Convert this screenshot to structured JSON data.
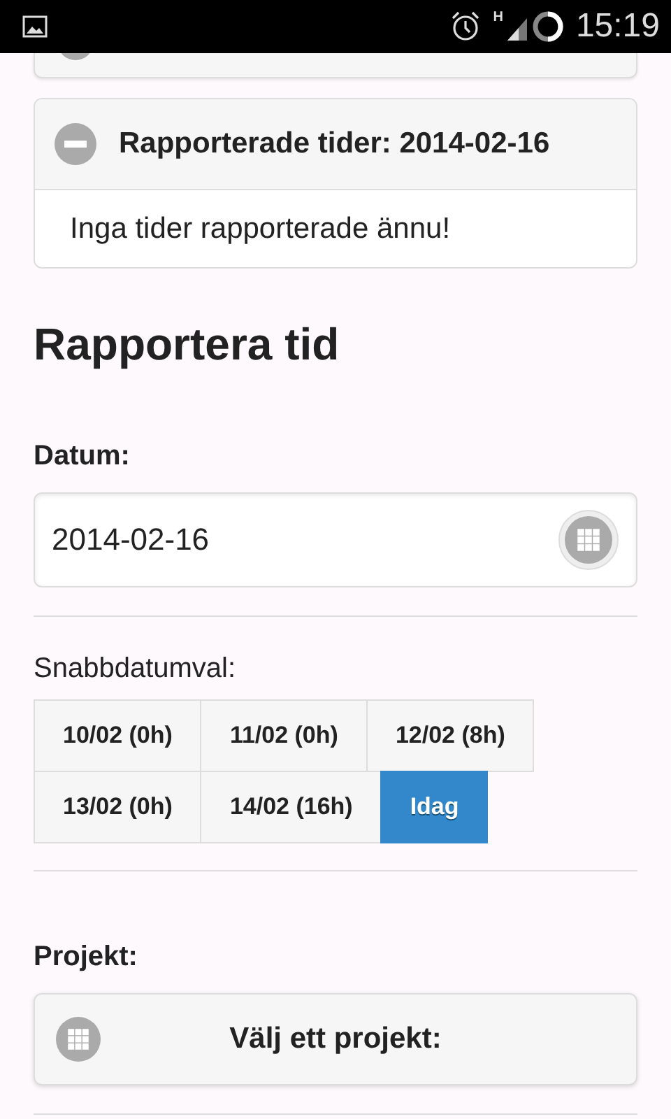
{
  "status_bar": {
    "time": "15:19",
    "network": "H"
  },
  "reported_panel": {
    "title": "Rapporterade tider: 2014-02-16",
    "expanded": true,
    "message": "Inga tider rapporterade ännu!"
  },
  "heading": "Rapportera tid",
  "date_field": {
    "label": "Datum:",
    "value": "2014-02-16"
  },
  "quick_dates": {
    "label": "Snabbdatumval:",
    "items": [
      {
        "label": "10/02 (0h)",
        "selected": false
      },
      {
        "label": "11/02 (0h)",
        "selected": false
      },
      {
        "label": "12/02 (8h)",
        "selected": false
      },
      {
        "label": "13/02 (0h)",
        "selected": false
      },
      {
        "label": "14/02 (16h)",
        "selected": false
      },
      {
        "label": "Idag",
        "selected": true
      }
    ]
  },
  "project": {
    "label": "Projekt:",
    "button": "Välj ett projekt:"
  }
}
